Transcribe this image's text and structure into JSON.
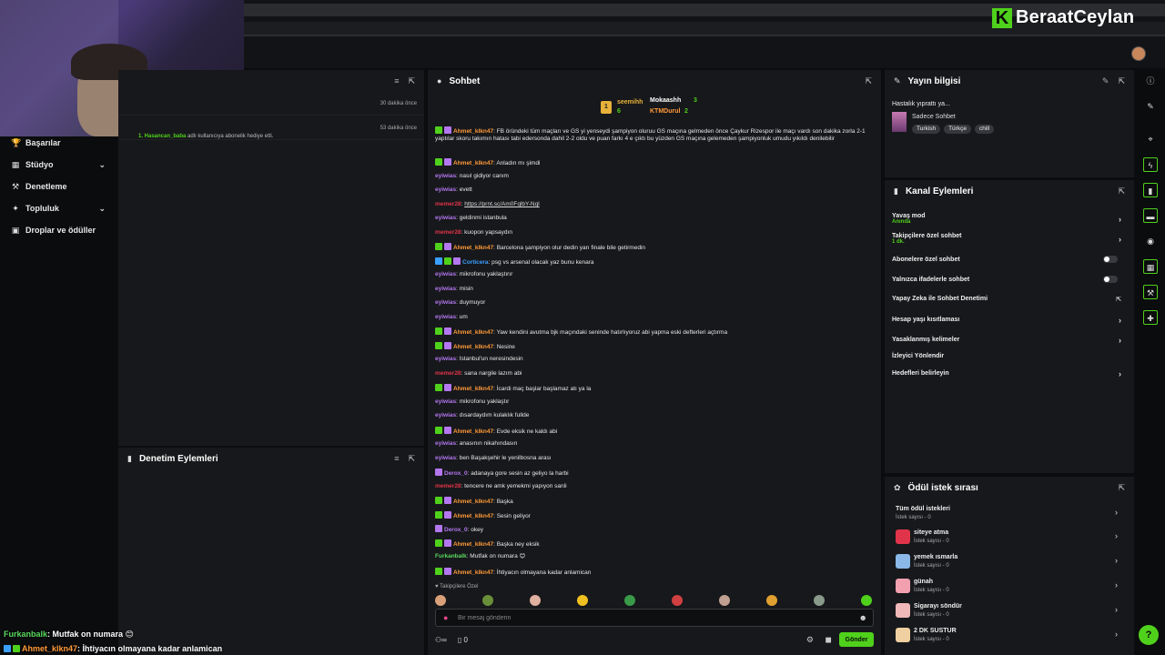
{
  "brand": {
    "name": "BeraatCeylan",
    "logo_letter": "K",
    "accent": "#4fd11c"
  },
  "left_nav": {
    "items": [
      {
        "label": "Başarılar",
        "icon": "trophy-icon",
        "has_chevron": false
      },
      {
        "label": "Stüdyo",
        "icon": "studio-icon",
        "has_chevron": true
      },
      {
        "label": "Denetleme",
        "icon": "hammer-icon",
        "has_chevron": false
      },
      {
        "label": "Topluluk",
        "icon": "community-icon",
        "has_chevron": true
      },
      {
        "label": "Droplar ve ödüller",
        "icon": "gift-icon",
        "has_chevron": false
      }
    ]
  },
  "notifications": {
    "rows": [
      {
        "time": "30 dakika önce"
      },
      {
        "time": "53 dakika önce"
      }
    ],
    "gift_line_user": "1. Hasancan_baba",
    "gift_line_text": "adlı kullanıcıya abonelik hediye etti."
  },
  "denetim": {
    "title": "Denetim Eylemleri"
  },
  "chat": {
    "title": "Sohbet",
    "leaderboard": {
      "first_rank": "1",
      "first_name": "seemihh",
      "first_score": "6",
      "second_name": "Mokaashh",
      "second_score": "3",
      "third_name": "KTMDurul",
      "third_score": "2"
    },
    "messages": [
      {
        "user": "Ahmet_klkn47",
        "color": "ahmet",
        "badges": [
          "g",
          "p"
        ],
        "text": ": FB öründeki tüm maçları ve GS yi yenseydi şampiyon oluruu GS maçına gelmeden önce Çaykur Rizespor ile maçı vardı son dakika zorla 2-1 yaptılar skoru takımın hatası tabi edersonda dahil 2-2 oldu ve puan farkı 4 e çıktı bu yüzden GS maçına gelemeden şampiyonluk umudu yıkıldı denilebilir",
        "wrap": true
      },
      {
        "user": "Ahmet_klkn47",
        "color": "ahmet",
        "badges": [
          "g",
          "p"
        ],
        "text": ": Anladın mı şimdi"
      },
      {
        "user": "eyiwias",
        "color": "eyl",
        "badges": [],
        "text": ": nasıl gidiyor canım"
      },
      {
        "user": "eyiwias",
        "color": "eyl",
        "badges": [],
        "text": ": evett"
      },
      {
        "user": "memer28",
        "color": "mem",
        "badges": [],
        "text": ": ",
        "link": "https://prnt.sc/Am0FqlbY-Nql"
      },
      {
        "user": "eyiwias",
        "color": "eyl",
        "badges": [],
        "text": ": geldinmi istanbula"
      },
      {
        "user": "memer28",
        "color": "mem",
        "badges": [],
        "text": ": kuopon yapsaydın"
      },
      {
        "user": "Ahmet_klkn47",
        "color": "ahmet",
        "badges": [
          "g",
          "p"
        ],
        "text": ": Barcelona şampiyon olur dedin yarı finale bile getirmedin"
      },
      {
        "user": "Corticera",
        "color": "cort",
        "badges": [
          "b",
          "g",
          "p"
        ],
        "text": ": psg vs arsenal olacak yaz bunu kenara"
      },
      {
        "user": "eyiwias",
        "color": "eyl",
        "badges": [],
        "text": ": mikrofonu yaklaştırır"
      },
      {
        "user": "eyiwias",
        "color": "eyl",
        "badges": [],
        "text": ": misin"
      },
      {
        "user": "eyiwias",
        "color": "eyl",
        "badges": [],
        "text": ": duymuyor"
      },
      {
        "user": "eyiwias",
        "color": "eyl",
        "badges": [],
        "text": ": um"
      },
      {
        "user": "Ahmet_klkn47",
        "color": "ahmet",
        "badges": [
          "g",
          "p"
        ],
        "text": ": Yaw kendini avutma bjk maçındaki seninde hatırlıyoruz abi yapma eski defterleri açtırma"
      },
      {
        "user": "Ahmet_klkn47",
        "color": "ahmet",
        "badges": [
          "g",
          "p"
        ],
        "text": ": Nesine"
      },
      {
        "user": "eyiwias",
        "color": "eyl",
        "badges": [],
        "text": ": İstanbul'un neresindesin"
      },
      {
        "user": "memer28",
        "color": "mem",
        "badges": [],
        "text": ": sana nargile lazım abi"
      },
      {
        "user": "Ahmet_klkn47",
        "color": "ahmet",
        "badges": [
          "g",
          "p"
        ],
        "text": ": İcardi maç başlar başlamaz atı ya la"
      },
      {
        "user": "eyiwias",
        "color": "eyl",
        "badges": [],
        "text": ": mikrofonu yaklaştır"
      },
      {
        "user": "eyiwias",
        "color": "eyl",
        "badges": [],
        "text": ": dısardaydım kulaklık fullde"
      },
      {
        "user": "Ahmet_klkn47",
        "color": "ahmet",
        "badges": [
          "g",
          "p"
        ],
        "text": ": Evde eksik ne kaldı abi"
      },
      {
        "user": "eyiwias",
        "color": "eyl",
        "badges": [],
        "text": ": anasının nikahındasın"
      },
      {
        "user": "eyiwias",
        "color": "eyl",
        "badges": [],
        "text": ": ben Başakşehir le yenilbosna arası"
      },
      {
        "user": "Derox_0",
        "color": "derox",
        "badges": [
          "p"
        ],
        "text": ": adanaya gore sesin az geliyo la harbi"
      },
      {
        "user": "memer28",
        "color": "mem",
        "badges": [],
        "text": ": tencere ne amk yemekmi yapıyon sanli"
      },
      {
        "user": "Ahmet_klkn47",
        "color": "ahmet",
        "badges": [
          "g",
          "p"
        ],
        "text": ": Başka"
      },
      {
        "user": "Ahmet_klkn47",
        "color": "ahmet",
        "badges": [
          "g",
          "p"
        ],
        "text": ": Sesin geliyor"
      },
      {
        "user": "Derox_0",
        "color": "derox",
        "badges": [
          "p"
        ],
        "text": ": okey"
      },
      {
        "user": "Ahmet_klkn47",
        "color": "ahmet",
        "badges": [
          "g",
          "p"
        ],
        "text": ": Başka ney eksik"
      },
      {
        "user": "Furkanbalk",
        "color": "furkan",
        "badges": [],
        "text": ": Mutfak on numara 😊"
      },
      {
        "user": "Ahmet_klkn47",
        "color": "ahmet",
        "badges": [
          "g",
          "p"
        ],
        "text": ": İhtiyacın olmayana kadar anlamican"
      }
    ],
    "followers_label": "Takipçilere Özel",
    "emote_colors": [
      "#d9a07a",
      "#6a8f3a",
      "#e0b0a0",
      "#f0c020",
      "#3a9a4a",
      "#d04040",
      "#c0a090",
      "#e0a030",
      "#8a9a8a",
      "#4fd11c"
    ],
    "input_placeholder": "Bir mesaj gönderin",
    "infinity_label": "∞",
    "count_label": "0",
    "send_label": "Gönder"
  },
  "yayin": {
    "title": "Yayın bilgisi",
    "stream_title": "Hastalık yıprattı ya...",
    "category": "Sadece Sohbet",
    "tags": [
      "Turkish",
      "Türkçe",
      "chill"
    ]
  },
  "kanal": {
    "title": "Kanal Eylemleri",
    "rows": [
      {
        "label": "Yavaş mod",
        "sub": "Anında",
        "control": "arrow"
      },
      {
        "label": "Takipçilere özel sohbet",
        "sub": "1 dk.",
        "control": "arrow"
      },
      {
        "label": "Abonelere özel sohbet",
        "sub": "",
        "control": "toggle"
      },
      {
        "label": "Yalnızca ifadelerle sohbet",
        "sub": "",
        "control": "toggle"
      },
      {
        "label": "Yapay Zeka ile Sohbet Denetimi",
        "sub": "",
        "control": "external"
      },
      {
        "label": "Hesap yaşı kısıtlaması",
        "sub": "",
        "control": "arrow"
      },
      {
        "label": "Yasaklanmış kelimeler",
        "sub": "",
        "control": "arrow"
      },
      {
        "label": "İzleyici Yönlendir",
        "sub": "",
        "control": "none"
      },
      {
        "label": "Hedefleri belirleyin",
        "sub": "",
        "control": "arrow"
      }
    ]
  },
  "odul": {
    "title": "Ödül istek sırası",
    "all_label": "Tüm ödül istekleri",
    "all_count": "İstek sayısı - 0",
    "items": [
      {
        "name": "siteye atma",
        "count": "İstek sayısı - 0",
        "color": "#e0344a"
      },
      {
        "name": "yemek ısmarla",
        "count": "İstek sayısı - 0",
        "color": "#8ab8e8"
      },
      {
        "name": "günah",
        "count": "İstek sayısı - 0",
        "color": "#f2a0b0"
      },
      {
        "name": "Sigarayı söndür",
        "count": "İstek sayısı - 0",
        "color": "#f0b8b8"
      },
      {
        "name": "2 DK SUSTUR",
        "count": "İstek sayısı - 0",
        "color": "#f0d0a0"
      }
    ]
  },
  "overlay": {
    "line1_user": "Furkanbalk",
    "line1_text": ": Mutfak on numara 😊",
    "line2_user": "Ahmet_klkn47",
    "line2_text": ": İhtiyacın olmayana kadar anlamican"
  }
}
